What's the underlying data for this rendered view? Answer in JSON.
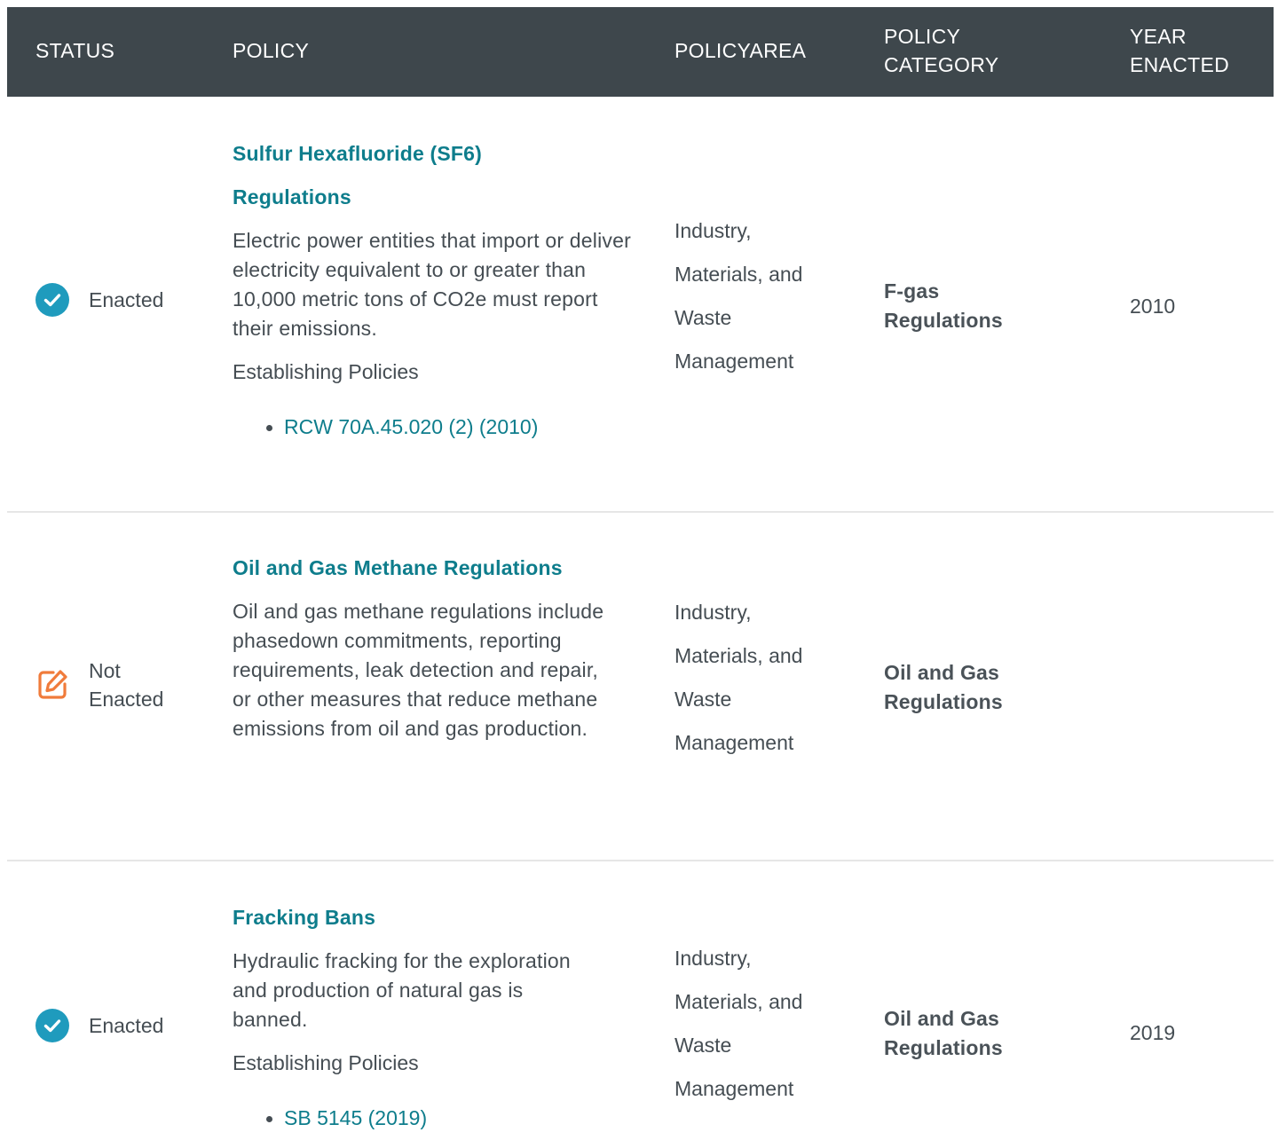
{
  "header": {
    "status": "STATUS",
    "policy": "POLICY",
    "policy_area": "POLICYAREA",
    "policy_category_line1": "POLICY",
    "policy_category_line2": "CATEGORY",
    "year_line1": "YEAR",
    "year_line2": "ENACTED"
  },
  "colors": {
    "header_bg": "#3e474c",
    "link": "#0e7d8c",
    "enacted_icon": "#1f9bbd",
    "not_enacted_icon": "#f07b3b"
  },
  "rows": [
    {
      "status": {
        "icon": "check-circle-icon",
        "line1": "Enacted",
        "line2": ""
      },
      "policy_title_line1": "Sulfur Hexafluoride (SF6)",
      "policy_title_line2": "Regulations",
      "policy_desc": "Electric power entities that import or deliver electricity equivalent to or greater than 10,000 metric tons of CO2e must report their emissions.",
      "establishing_label": "Establishing Policies",
      "establishing_links": [
        "RCW 70A.45.020 (2) (2010)"
      ],
      "area_lines": [
        "Industry,",
        "Materials, and",
        "Waste",
        "Management"
      ],
      "category_line1": "F-gas",
      "category_line2": "Regulations",
      "year": "2010"
    },
    {
      "status": {
        "icon": "edit-square-icon",
        "line1": "Not",
        "line2": "Enacted"
      },
      "policy_title_line1": "Oil and Gas Methane Regulations",
      "policy_desc": "Oil and gas methane regulations include phasedown commitments, reporting requirements, leak detection and repair, or other measures that reduce methane emissions from oil and gas production.",
      "area_lines": [
        "Industry,",
        "Materials, and",
        "Waste",
        "Management"
      ],
      "category_line1": "Oil and Gas",
      "category_line2": "Regulations",
      "year": ""
    },
    {
      "status": {
        "icon": "check-circle-icon",
        "line1": "Enacted",
        "line2": ""
      },
      "policy_title_line1": "Fracking Bans",
      "policy_desc": "Hydraulic fracking for the exploration and production of natural gas is banned.",
      "establishing_label": "Establishing Policies",
      "establishing_links": [
        "SB 5145 (2019)"
      ],
      "area_lines": [
        "Industry,",
        "Materials, and",
        "Waste",
        "Management"
      ],
      "category_line1": "Oil and Gas",
      "category_line2": "Regulations",
      "year": "2019"
    }
  ]
}
